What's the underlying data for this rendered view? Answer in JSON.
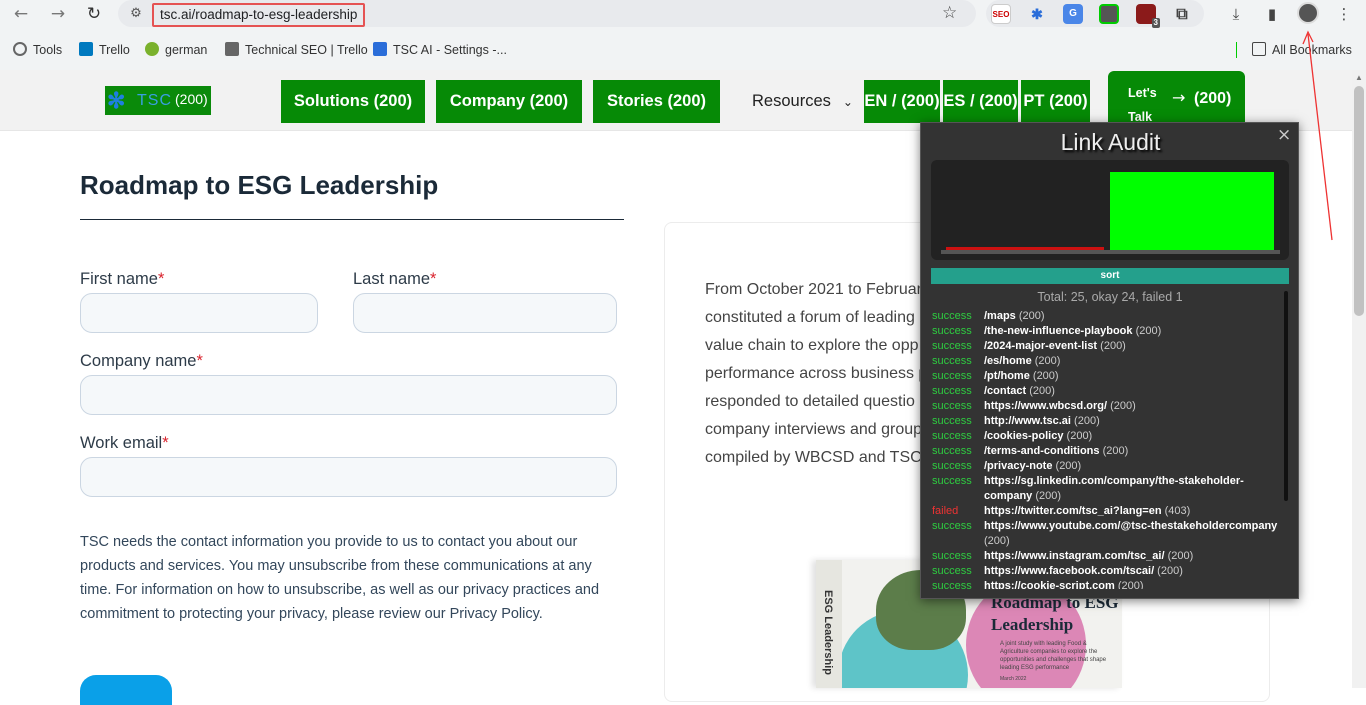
{
  "browser": {
    "url": "tsc.ai/roadmap-to-esg-leadership",
    "bookmarks": [
      {
        "label": "Tools",
        "color": "#666"
      },
      {
        "label": "Trello",
        "color": "#0079bf"
      },
      {
        "label": "german",
        "color": "#7ab12c"
      },
      {
        "label": "Technical SEO | Trello",
        "color": "#666"
      },
      {
        "label": "TSC AI - Settings -...",
        "color": "#2a6dd9"
      }
    ],
    "all_bookmarks": "All Bookmarks",
    "ext_badge": "3"
  },
  "header": {
    "logo_text": "TSC",
    "logo_count": "(200)",
    "nav": [
      {
        "label": "Solutions (200)"
      },
      {
        "label": "Company (200)"
      },
      {
        "label": "Stories (200)"
      }
    ],
    "resources": "Resources",
    "langs": [
      {
        "label": "EN / (200)"
      },
      {
        "label": "ES / (200)"
      },
      {
        "label": "PT (200)"
      }
    ],
    "talk_label": "Let's Talk",
    "talk_count": "(200)"
  },
  "page": {
    "title": "Roadmap to ESG Leadership",
    "first_name": "First name",
    "last_name": "Last name",
    "company_name": "Company name",
    "work_email": "Work email",
    "required_mark": "*",
    "notice": "TSC needs the contact information you provide to us to contact you about our products and services. You may unsubscribe from these communications at any time. For information on how to unsubscribe, as well as our privacy practices and commitment to protecting your privacy, please review our Privacy Policy.",
    "card_lines": [
      "From October 2021 to Februar",
      "constituted a forum of leading",
      "value chain to explore the opp",
      "performance across business p",
      "responded to detailed questio",
      "company interviews and group",
      "compiled by WBCSD and TSC i"
    ],
    "book_title": "Roadmap to ESG Leadership",
    "book_spine": "ESG Leadership",
    "book_blurb": "A joint study with leading Food & Agriculture companies to explore the opportunities and challenges that shape leading ESG performance",
    "book_date": "March 2022"
  },
  "audit": {
    "title": "Link Audit",
    "close": "×",
    "sort_label": "sort",
    "total_text": "Total: 25, okay 24, failed 1",
    "chart": {
      "failed": 1,
      "okay": 24
    },
    "colors": {
      "ok": "#00ff00",
      "failed": "#cc1111"
    },
    "rows": [
      {
        "status": "success",
        "link": "/maps",
        "code": "(200)"
      },
      {
        "status": "success",
        "link": "/the-new-influence-playbook",
        "code": "(200)"
      },
      {
        "status": "success",
        "link": "/2024-major-event-list",
        "code": "(200)"
      },
      {
        "status": "success",
        "link": "/es/home",
        "code": "(200)"
      },
      {
        "status": "success",
        "link": "/pt/home",
        "code": "(200)"
      },
      {
        "status": "success",
        "link": "/contact",
        "code": "(200)"
      },
      {
        "status": "success",
        "link": "https://www.wbcsd.org/",
        "code": "(200)"
      },
      {
        "status": "success",
        "link": "http://www.tsc.ai",
        "code": "(200)"
      },
      {
        "status": "success",
        "link": "/cookies-policy",
        "code": "(200)"
      },
      {
        "status": "success",
        "link": "/terms-and-conditions",
        "code": "(200)"
      },
      {
        "status": "success",
        "link": "/privacy-note",
        "code": "(200)"
      },
      {
        "status": "success",
        "link": "https://sg.linkedin.com/company/the-stakeholder-company",
        "code": "(200)"
      },
      {
        "status": "failed",
        "link": "https://twitter.com/tsc_ai?lang=en",
        "code": "(403)"
      },
      {
        "status": "success",
        "link": "https://www.youtube.com/@tsc-thestakeholdercompany",
        "code": "(200)"
      },
      {
        "status": "success",
        "link": "https://www.instagram.com/tsc_ai/",
        "code": "(200)"
      },
      {
        "status": "success",
        "link": "https://www.facebook.com/tscai/",
        "code": "(200)"
      },
      {
        "status": "success",
        "link": "https://cookie-script.com",
        "code": "(200)"
      }
    ]
  }
}
